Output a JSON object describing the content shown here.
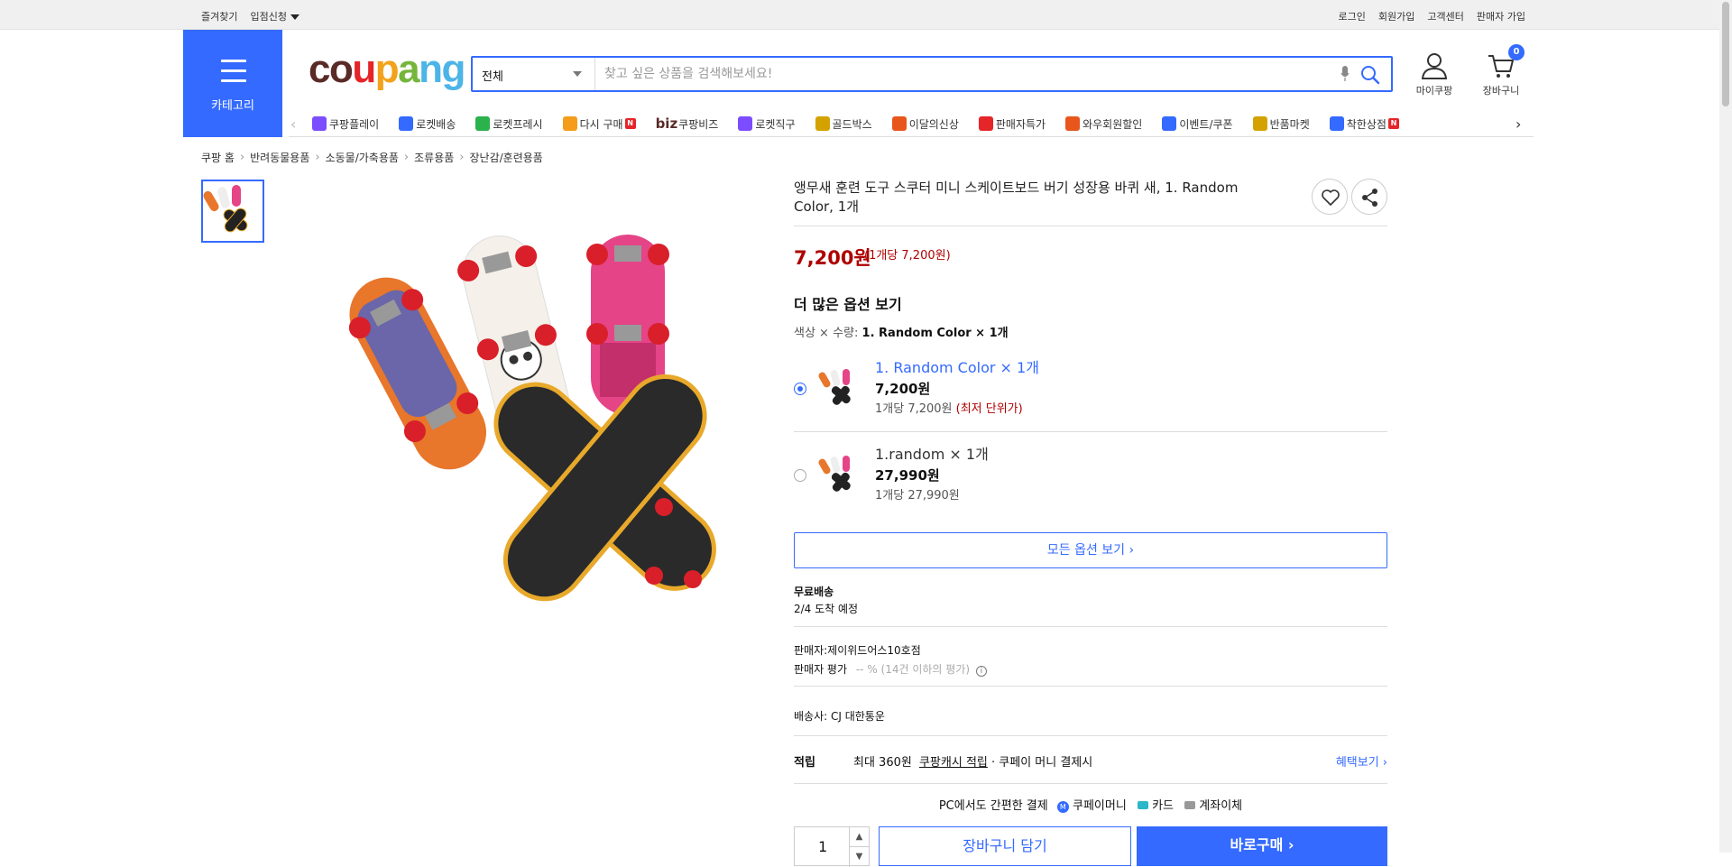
{
  "topbar": {
    "left": [
      "즐겨찾기",
      "입점신청"
    ],
    "right": [
      "로그인",
      "회원가입",
      "고객센터",
      "판매자 가입"
    ]
  },
  "category_button": "카테고리",
  "logo": [
    "c",
    "o",
    "u",
    "p",
    "a",
    "ng"
  ],
  "search": {
    "category": "전체",
    "placeholder": "찾고 싶은 상품을 검색해보세요!"
  },
  "header_icons": {
    "my": "마이쿠팡",
    "cart": "장바구니",
    "cart_count": "0"
  },
  "nav_items": [
    {
      "label": "쿠팡플레이",
      "color": "#7b4dff",
      "new": false
    },
    {
      "label": "로켓배송",
      "color": "#346aff",
      "new": false
    },
    {
      "label": "로켓프레시",
      "color": "#2bb24c",
      "new": false
    },
    {
      "label": "다시 구매",
      "color": "#f59c1a",
      "new": true
    },
    {
      "label": "쿠팡비즈",
      "color": "#5a2a27",
      "new": false
    },
    {
      "label": "로켓직구",
      "color": "#7b4dff",
      "new": false
    },
    {
      "label": "골드박스",
      "color": "#d4a200",
      "new": false
    },
    {
      "label": "이달의신상",
      "color": "#e8561c",
      "new": false
    },
    {
      "label": "판매자특가",
      "color": "#e52528",
      "new": false
    },
    {
      "label": "와우회원할인",
      "color": "#e8561c",
      "new": false
    },
    {
      "label": "이벤트/쿠폰",
      "color": "#346aff",
      "new": false
    },
    {
      "label": "반품마켓",
      "color": "#d4a200",
      "new": false
    },
    {
      "label": "착한상점",
      "color": "#346aff",
      "new": true
    }
  ],
  "biz_prefix": "biz",
  "breadcrumb": [
    "쿠팡 홈",
    "반려동물용품",
    "소동물/가축용품",
    "조류용품",
    "장난감/훈련용품"
  ],
  "product": {
    "title": "앵무새 훈련 도구 스쿠터 미니 스케이트보드 버기 성장용 바퀴 새, 1. Random Color, 1개",
    "price": "7,200원",
    "unit_price": "(1개당 7,200원)",
    "more_options": "더 많은 옵션 보기",
    "option_label": "색상 × 수량:",
    "option_value": "1. Random Color × 1개",
    "options": [
      {
        "name": "1. Random Color × 1개",
        "price": "7,200원",
        "unit": "1개당 7,200원",
        "best": "(최저 단위가)",
        "selected": true
      },
      {
        "name": "1.random × 1개",
        "price": "27,990원",
        "unit": "1개당 27,990원",
        "best": "",
        "selected": false
      }
    ],
    "all_options": "모든 옵션 보기 ›",
    "shipping_free": "무료배송",
    "arrival": "2/4 도착 예정",
    "seller": "판매자:제이위드어스10호점",
    "seller_rating_label": "판매자 평가",
    "seller_rating": "-- % (14건 이하의 평가)",
    "delivery_company": "배송사:  CJ 대한통운",
    "reward_label": "적립",
    "reward_text_1": "최대 360원",
    "reward_link": "쿠팡캐시 적립",
    "reward_text_2": "· 쿠페이 머니 결제시",
    "benefit_link": "혜택보기 ›",
    "pay_text": "PC에서도 간편한 결제",
    "pay_methods": [
      "쿠페이머니",
      "카드",
      "계좌이체"
    ],
    "qty": "1",
    "add_cart": "장바구니 담기",
    "buy_now": "바로구매 ›"
  }
}
